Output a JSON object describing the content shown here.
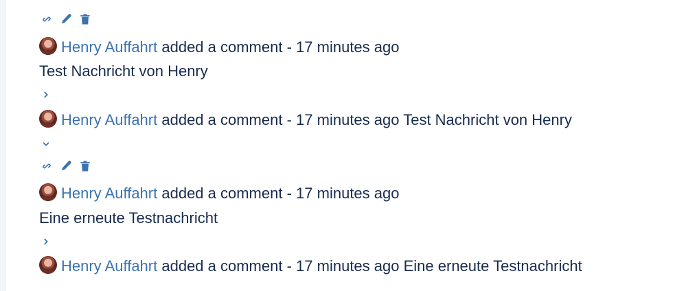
{
  "comments": [
    {
      "author": "Henry Auffahrt",
      "action_text": "added a comment",
      "separator": "-",
      "time": "17 minutes ago",
      "body": "Test Nachricht von Henry",
      "collapsed_summary": "Test Nachricht von Henry"
    },
    {
      "author": "Henry Auffahrt",
      "action_text": "added a comment",
      "separator": "-",
      "time": "17 minutes ago",
      "body": "Eine erneute Testnachricht",
      "collapsed_summary": "Eine erneute Testnachricht"
    }
  ],
  "icons": {
    "permalink": "link-icon",
    "edit": "pencil-icon",
    "delete": "trash-icon",
    "expand": "chevron-right-icon",
    "collapse": "chevron-down-icon"
  },
  "colors": {
    "link": "#3b73af",
    "text": "#172b4d",
    "rail": "#f4f5f7"
  }
}
